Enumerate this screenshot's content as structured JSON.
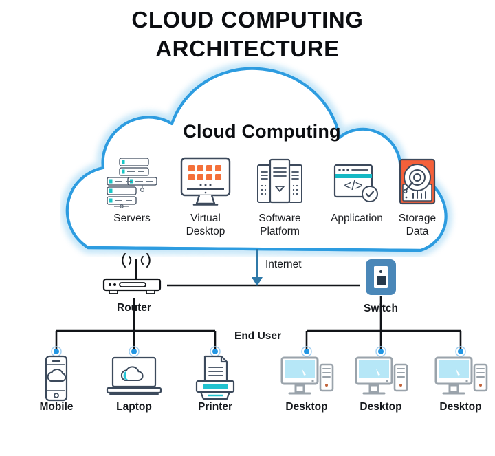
{
  "title": {
    "line1": "CLOUD COMPUTING",
    "line2": "ARCHITECTURE"
  },
  "cloud": {
    "label": "Cloud Computing",
    "stroke_color": "#2d9ce0",
    "glow_color": "#cfe8f8",
    "services": [
      {
        "id": "servers",
        "label_line1": "Servers",
        "label_line2": "",
        "icon": "servers-icon",
        "accent": "#17c3c3"
      },
      {
        "id": "virtual-desktop",
        "label_line1": "Virtual",
        "label_line2": "Desktop",
        "icon": "virtual-desktop-icon",
        "accent": "#f4703a"
      },
      {
        "id": "software-platform",
        "label_line1": "Software",
        "label_line2": "Platform",
        "icon": "software-platform-icon",
        "accent": "#3a4556"
      },
      {
        "id": "application",
        "label_line1": "Application",
        "label_line2": "",
        "icon": "application-icon",
        "accent": "#14b8c4"
      },
      {
        "id": "storage-data",
        "label_line1": "Storage",
        "label_line2": "Data",
        "icon": "storage-data-icon",
        "accent": "#f4603a"
      }
    ]
  },
  "network": {
    "internet_label": "Internet",
    "end_user_label": "End User",
    "internet_arrow_color": "#2f79a8",
    "router": {
      "label": "Router",
      "icon": "router-icon"
    },
    "switch": {
      "label": "Switch",
      "icon": "switch-icon",
      "color": "#4a87b8"
    },
    "connector_dot_color": "#2196e3"
  },
  "devices": [
    {
      "id": "mobile",
      "label": "Mobile",
      "icon": "mobile-phone-icon",
      "accent": "#3c4a5c"
    },
    {
      "id": "laptop",
      "label": "Laptop",
      "icon": "laptop-icon",
      "accent": "#24c4d6"
    },
    {
      "id": "printer",
      "label": "Printer",
      "icon": "printer-icon",
      "accent": "#21c2cf"
    },
    {
      "id": "desktop-1",
      "label": "Desktop",
      "icon": "desktop-computer-icon",
      "accent": "#b6e7f7"
    },
    {
      "id": "desktop-2",
      "label": "Desktop",
      "icon": "desktop-computer-icon",
      "accent": "#b6e7f7"
    },
    {
      "id": "desktop-3",
      "label": "Desktop",
      "icon": "desktop-computer-icon",
      "accent": "#b6e7f7"
    }
  ]
}
